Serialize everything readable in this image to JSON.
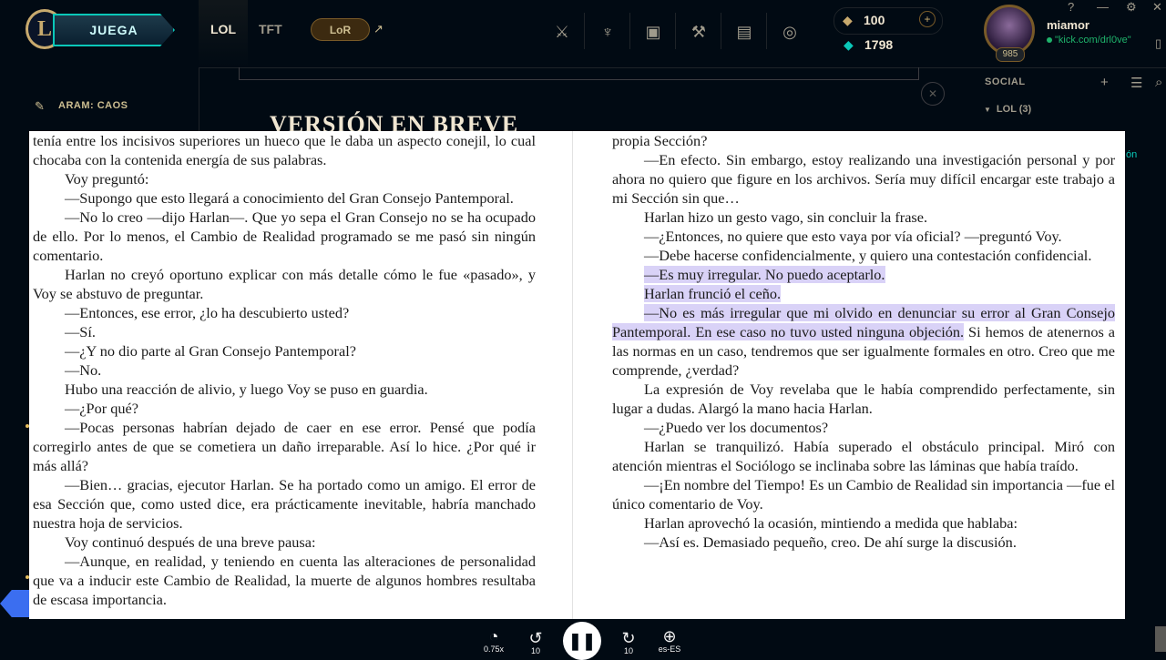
{
  "topbar": {
    "logo": "L",
    "play_label": "JUEGA",
    "tabs": [
      {
        "label": "LOL",
        "active": true
      },
      {
        "label": "TFT",
        "active": false
      }
    ],
    "lor_label": "LoR",
    "lor_external": "↗",
    "icons": [
      "clash-icon",
      "tft-pass-icon",
      "store-icon",
      "crafting-icon",
      "collection-icon",
      "loot-icon"
    ],
    "currency": {
      "rp_symbol": "◆",
      "rp": "100",
      "plus": "+",
      "be_symbol": "◆",
      "be": "1798"
    },
    "user": {
      "name": "miamor",
      "status": "\"kick.com/drl0ve\"",
      "level": "985"
    },
    "window": {
      "help": "?",
      "minimize": "—",
      "settings": "⚙",
      "close": "✕",
      "extra": "▯"
    }
  },
  "left_panel": {
    "mode_icon": "✎",
    "mode": "ARAM: CAOS"
  },
  "center": {
    "heading_peek": "VERSIÓN EN BREVE",
    "mute_icon": "✕"
  },
  "social": {
    "title": "SOCIAL",
    "add_friend": "+",
    "list_icon": "☰",
    "search_icon": "⌕",
    "group_arrow": "▼",
    "group": "LOL (3)",
    "right_peek": "ón"
  },
  "book": {
    "left_paragraphs": [
      {
        "t": "tenía entre los incisivos superiores un hueco que le daba un aspecto conejil, lo cual chocaba con la contenida energía de sus palabras.",
        "noindent": true
      },
      {
        "t": "Voy preguntó:"
      },
      {
        "t": "—Supongo que esto llegará a conocimiento del Gran Consejo Pantemporal."
      },
      {
        "t": "—No lo creo —dijo Harlan—. Que yo sepa el Gran Consejo no se ha ocupado de ello. Por lo menos, el Cambio de Realidad programado se me pasó sin ningún comentario."
      },
      {
        "t": "Harlan no creyó oportuno explicar con más detalle cómo le fue «pasado», y Voy se abstuvo de preguntar."
      },
      {
        "t": "—Entonces, ese error, ¿lo ha descubierto usted?"
      },
      {
        "t": "—Sí."
      },
      {
        "t": "—¿Y no dio parte al Gran Consejo Pantemporal?"
      },
      {
        "t": "—No."
      },
      {
        "t": "Hubo una reacción de alivio, y luego Voy se puso en guardia."
      },
      {
        "t": "—¿Por qué?"
      },
      {
        "t": "—Pocas personas habrían dejado de caer en ese error. Pensé que podía corregirlo antes de que se cometiera un daño irreparable. Así lo hice. ¿Por qué ir más allá?"
      },
      {
        "t": "—Bien… gracias, ejecutor Harlan. Se ha portado como un amigo. El error de esa Sección que, como usted dice, era prácticamente inevitable, habría manchado nuestra hoja de servicios."
      },
      {
        "t": "Voy continuó después de una breve pausa:"
      },
      {
        "t": "—Aunque, en realidad, y teniendo en cuenta las alteraciones de personalidad que va a inducir este Cambio de Realidad, la muerte de algunos hombres resultaba de escasa importancia."
      }
    ],
    "right_paragraphs": [
      {
        "t": "propia Sección?",
        "noindent": true
      },
      {
        "t": "—En efecto. Sin embargo, estoy realizando una investigación personal y por ahora no quiero que figure en los archivos. Sería muy difícil encargar este trabajo a mi Sección sin que…"
      },
      {
        "t": "Harlan hizo un gesto vago, sin concluir la frase."
      },
      {
        "t": "—¿Entonces, no quiere que esto vaya por vía oficial? —preguntó Voy."
      },
      {
        "t": "—Debe hacerse confidencialmente, y quiero una contestación confidencial."
      },
      {
        "t": "—Es muy irregular. No puedo aceptarlo.",
        "hl": "all"
      },
      {
        "t": "Harlan frunció el ceño.",
        "hl": "all"
      },
      {
        "hl_part": "—No es más irregular que mi olvido en denunciar su error al Gran Consejo Pantemporal. En ese caso no tuvo usted ninguna objeción.",
        "rest": " Si hemos de atenernos a las normas en un caso, tendremos que ser igualmente formales en otro. Creo que me comprende, ¿verdad?"
      },
      {
        "t": "La expresión de Voy revelaba que le había comprendido perfectamente, sin lugar a dudas. Alargó la mano hacia Harlan."
      },
      {
        "t": "—¿Puedo ver los documentos?"
      },
      {
        "t": "Harlan se tranquilizó. Había superado el obstáculo principal. Miró con atención mientras el Sociólogo se inclinaba sobre las láminas que había traído."
      },
      {
        "t": "—¡En nombre del Tiempo! Es un Cambio de Realidad sin importancia —fue el único comentario de Voy."
      },
      {
        "t": "Harlan aprovechó la ocasión, mintiendo a medida que hablaba:"
      },
      {
        "t": "—Así es. Demasiado pequeño, creo. De ahí surge la discusión."
      }
    ]
  },
  "player": {
    "speed_icon": "◔",
    "speed": "0.75x",
    "rewind_icon": "↺",
    "rewind": "10",
    "pause_icon": "❚❚",
    "forward_icon": "↻",
    "forward": "10",
    "lang_icon": "⊕",
    "lang": "es-ES"
  },
  "colors": {
    "accent_teal": "#0ac8b9",
    "gold": "#c8aa6e",
    "highlight": "#d9d2f7",
    "background": "#010a13"
  }
}
